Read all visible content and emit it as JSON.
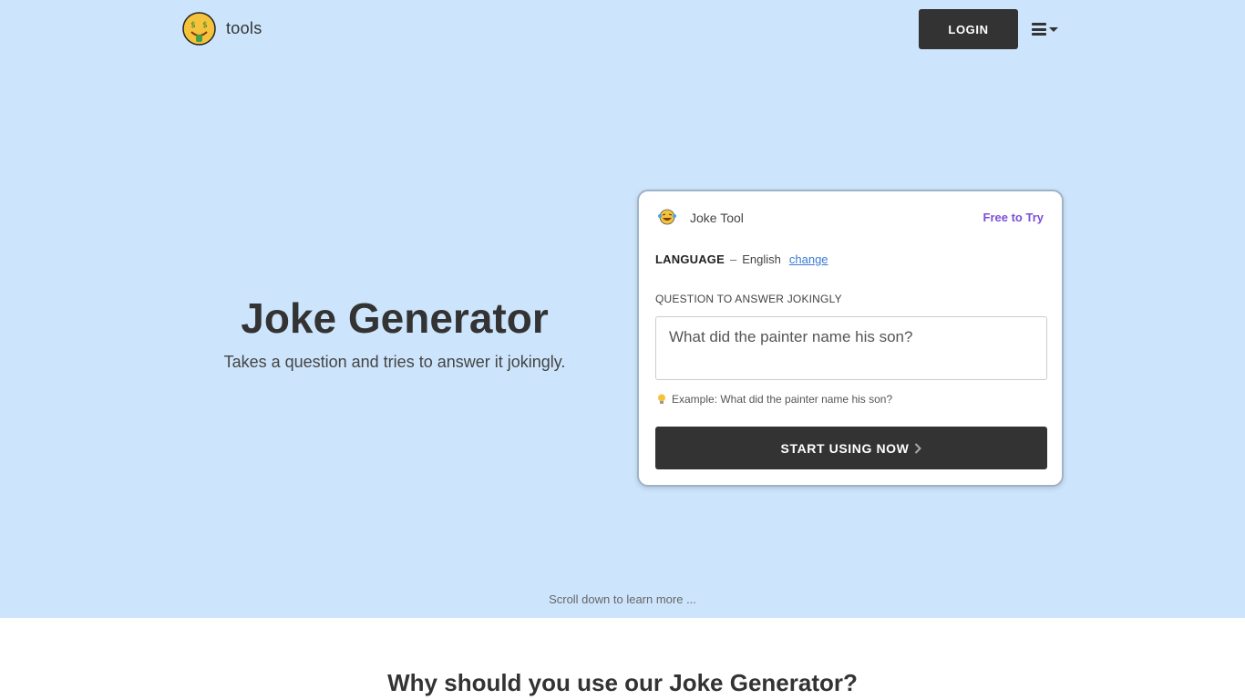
{
  "header": {
    "brand": "tools",
    "login_label": "LOGIN",
    "menu_icon": "hamburger-menu-icon"
  },
  "intro": {
    "title": "Joke Generator",
    "subtitle": "Takes a question and tries to answer it jokingly."
  },
  "card": {
    "tool_name": "Joke Tool",
    "badge": "Free to Try",
    "language_label": "LANGUAGE",
    "language_sep": "–",
    "language_value": "English",
    "language_change": "change",
    "question_label": "QUESTION TO ANSWER JOKINGLY",
    "question_placeholder": "What did the painter name his son?",
    "example": "Example: What did the painter name his son?",
    "start_label": "START USING NOW"
  },
  "footer": {
    "scroll_hint": "Scroll down to learn more ...",
    "why_heading": "Why should you use our Joke Generator?"
  },
  "colors": {
    "hero_bg": "#cde5fc",
    "button_dark": "#333333",
    "badge_purple": "#7b4fd9",
    "link_blue": "#3a7bd5"
  }
}
